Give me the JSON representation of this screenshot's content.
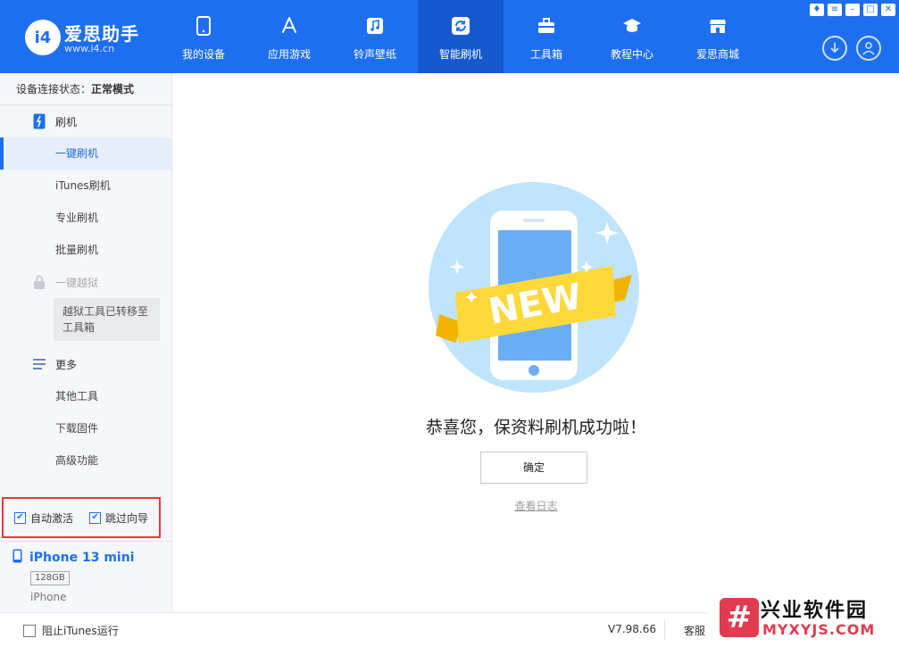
{
  "brand": {
    "logo_text": "i4",
    "name": "爱思助手",
    "url": "www.i4.cn"
  },
  "nav": [
    {
      "label": "我的设备",
      "icon": "phone-icon"
    },
    {
      "label": "应用游戏",
      "icon": "app-store-icon"
    },
    {
      "label": "铃声壁纸",
      "icon": "music-note-icon"
    },
    {
      "label": "智能刷机",
      "icon": "refresh-icon",
      "active": true
    },
    {
      "label": "工具箱",
      "icon": "toolbox-icon"
    },
    {
      "label": "教程中心",
      "icon": "graduation-cap-icon"
    },
    {
      "label": "爱思商城",
      "icon": "store-icon"
    }
  ],
  "sidebar": {
    "status_label": "设备连接状态：",
    "status_value": "正常模式",
    "flash_section": "刷机",
    "flash_items": [
      "一键刷机",
      "iTunes刷机",
      "专业刷机",
      "批量刷机"
    ],
    "jailbreak_section": "一键越狱",
    "jailbreak_note": "越狱工具已转移至工具箱",
    "more_section": "更多",
    "more_items": [
      "其他工具",
      "下载固件",
      "高级功能"
    ],
    "auto_activate": "自动激活",
    "skip_guide": "跳过向导",
    "device_name": "iPhone 13 mini",
    "device_capacity": "128GB",
    "device_type": "iPhone"
  },
  "main": {
    "badge": "NEW",
    "success_message": "恭喜您，保资料刷机成功啦！",
    "ok_button": "确定",
    "view_log": "查看日志"
  },
  "bottom": {
    "block_itunes": "阻止iTunes运行",
    "version": "V7.98.66",
    "service": "客服"
  },
  "watermark": {
    "mark": "#",
    "title": "兴业软件园",
    "url": "MYXYJS.COM"
  },
  "colors": {
    "primary": "#1e6ff0",
    "highlight_border": "#e23b3b"
  }
}
